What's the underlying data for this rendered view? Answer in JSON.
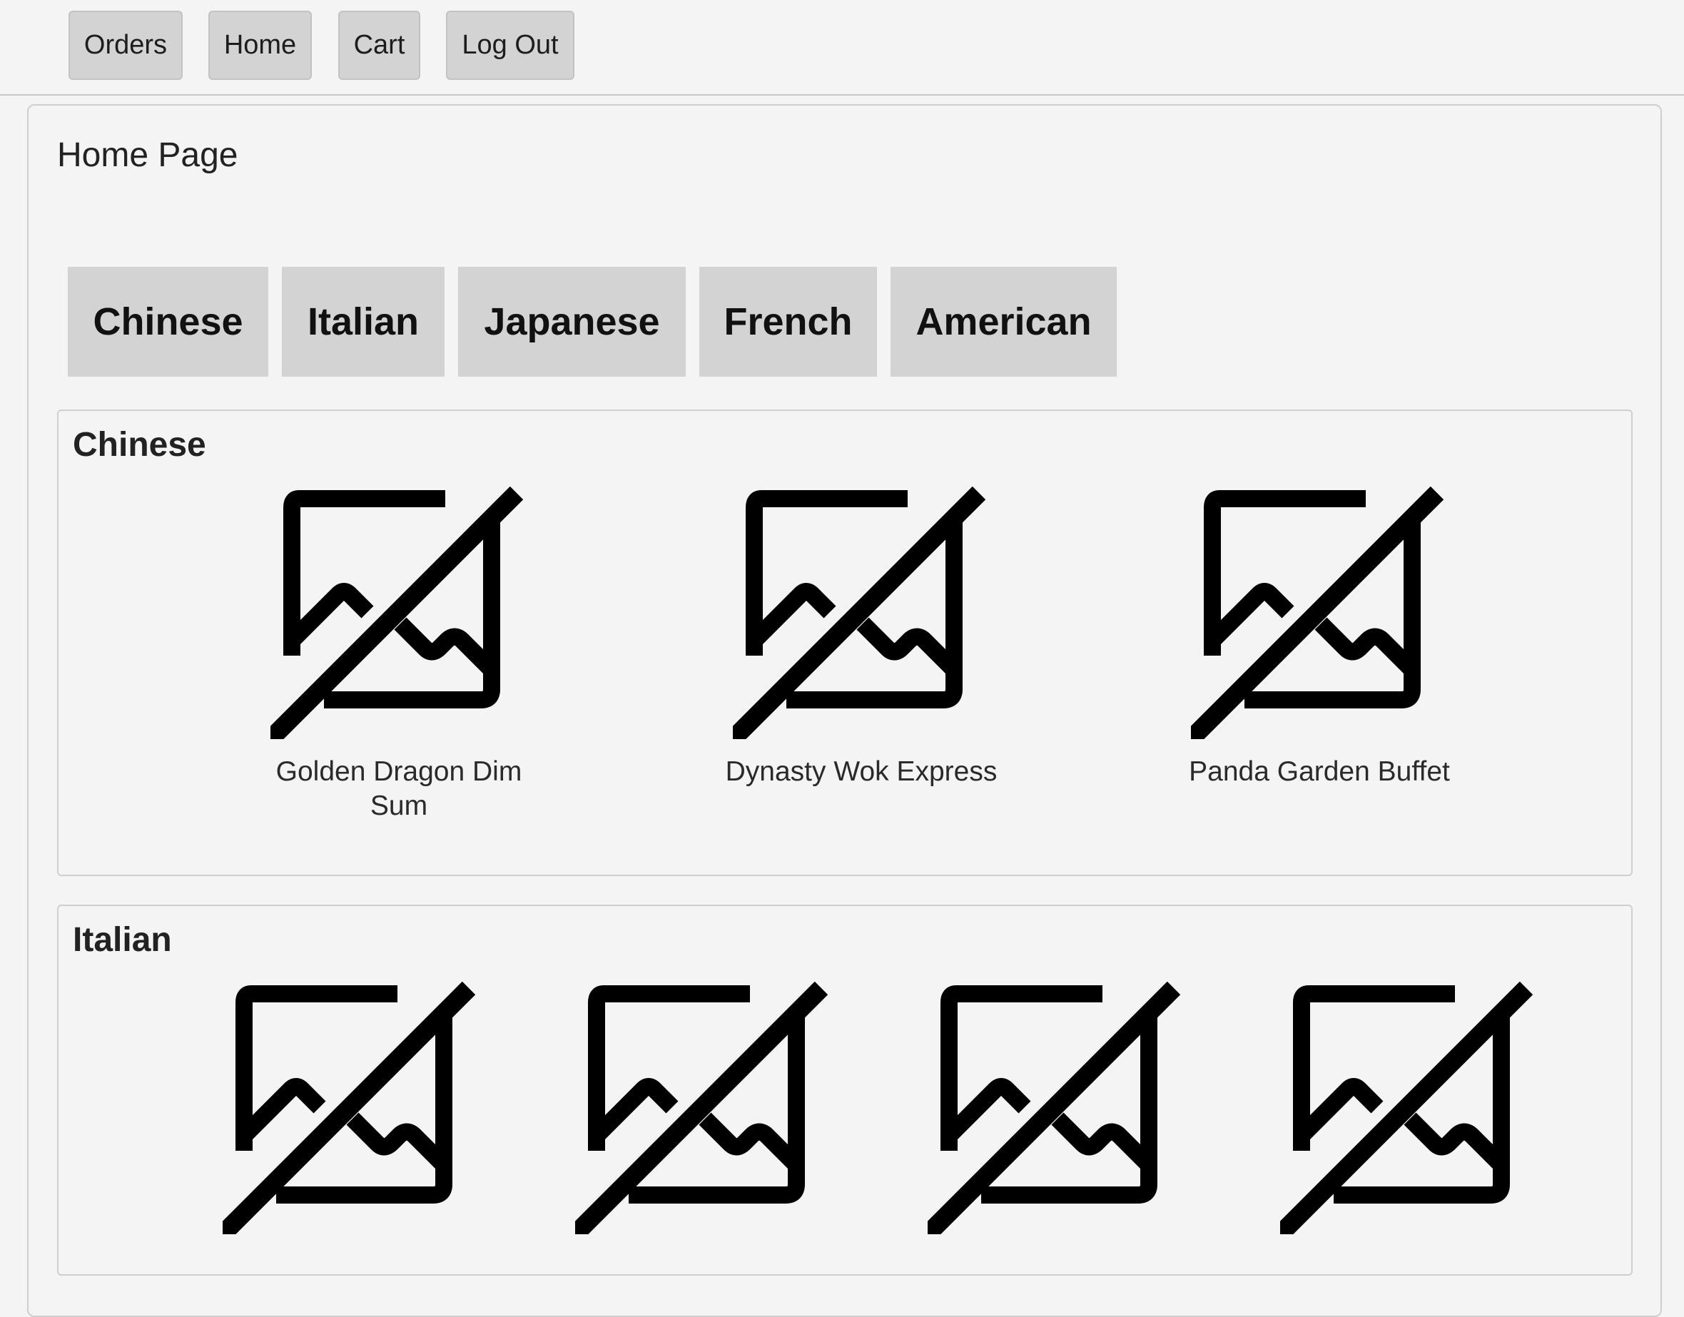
{
  "nav": {
    "items": [
      "Orders",
      "Home",
      "Cart",
      "Log Out"
    ]
  },
  "page": {
    "title": "Home Page"
  },
  "categories": [
    "Chinese",
    "Italian",
    "Japanese",
    "French",
    "American"
  ],
  "sections": [
    {
      "title": "Chinese",
      "restaurants": [
        {
          "name": "Golden Dragon Dim Sum",
          "image": "broken-image-icon"
        },
        {
          "name": "Dynasty Wok Express",
          "image": "broken-image-icon"
        },
        {
          "name": "Panda Garden Buffet",
          "image": "broken-image-icon"
        }
      ]
    },
    {
      "title": "Italian",
      "restaurants": [
        {
          "name": "",
          "image": "broken-image-icon"
        },
        {
          "name": "",
          "image": "broken-image-icon"
        },
        {
          "name": "",
          "image": "broken-image-icon"
        },
        {
          "name": "",
          "image": "broken-image-icon"
        }
      ]
    }
  ],
  "colors": {
    "background": "#f4f4f4",
    "button": "#d3d3d3",
    "border": "#cfcfcf",
    "icon": "#000000"
  }
}
